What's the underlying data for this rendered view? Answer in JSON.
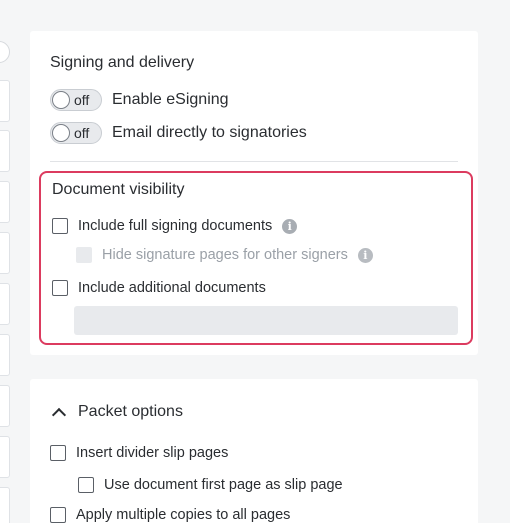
{
  "signing": {
    "title": "Signing and delivery",
    "toggles": [
      {
        "state": "off",
        "label": "Enable eSigning"
      },
      {
        "state": "off",
        "label": "Email directly to signatories"
      }
    ]
  },
  "visibility": {
    "title": "Document visibility",
    "include_full": "Include full signing documents",
    "hide_pages": "Hide signature pages for other signers",
    "include_additional": "Include additional documents",
    "highlight_color": "#dc3b5f"
  },
  "packet": {
    "title": "Packet options",
    "insert_divider": "Insert divider slip pages",
    "use_first_page": "Use document first page as slip page",
    "apply_copies": "Apply multiple copies to all pages"
  }
}
